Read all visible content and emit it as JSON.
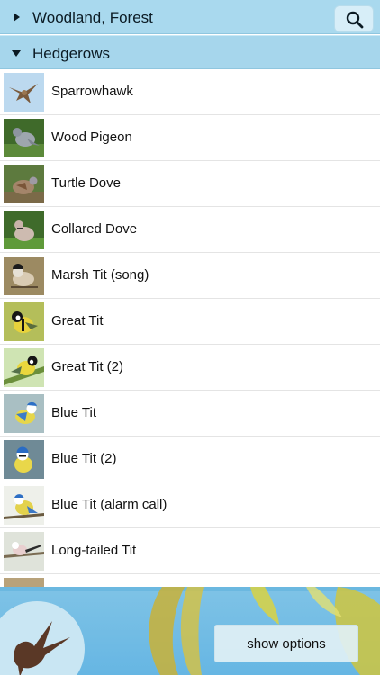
{
  "sections": {
    "collapsed": {
      "title": "Woodland, Forest"
    },
    "expanded": {
      "title": "Hedgerows"
    }
  },
  "search": {
    "icon": "search-icon"
  },
  "birds": [
    {
      "label": "Sparrowhawk"
    },
    {
      "label": "Wood Pigeon"
    },
    {
      "label": "Turtle Dove"
    },
    {
      "label": "Collared Dove"
    },
    {
      "label": "Marsh Tit (song)"
    },
    {
      "label": "Great Tit"
    },
    {
      "label": "Great Tit (2)"
    },
    {
      "label": "Blue Tit"
    },
    {
      "label": "Blue Tit (2)"
    },
    {
      "label": "Blue Tit (alarm call)"
    },
    {
      "label": "Long-tailed Tit"
    }
  ],
  "banner": {
    "options_label": "show options",
    "logo_icon": "swallow-logo-icon"
  },
  "colors": {
    "header": "#a9d9ee",
    "banner": "#7fc3e6"
  }
}
